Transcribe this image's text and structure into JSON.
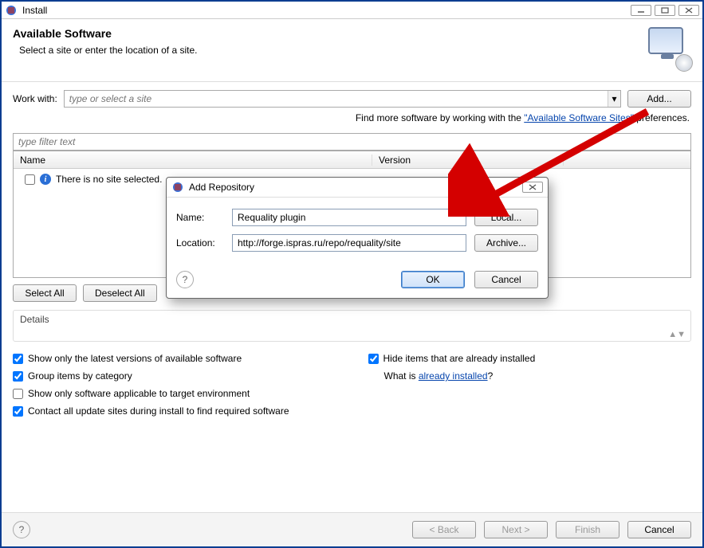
{
  "window": {
    "title": "Install",
    "min": "⎯",
    "max": "☐",
    "close": "✕"
  },
  "header": {
    "title": "Available Software",
    "subtitle": "Select a site or enter the location of a site."
  },
  "workwith": {
    "label": "Work with:",
    "placeholder": "type or select a site",
    "add_btn": "Add...",
    "hint_prefix": "Find more software by working with the ",
    "hint_link": "\"Available Software Sites\"",
    "hint_suffix": " preferences."
  },
  "filter": {
    "placeholder": "type filter text"
  },
  "table": {
    "col_name": "Name",
    "col_version": "Version",
    "empty_text": "There is no site selected."
  },
  "buttons": {
    "select_all": "Select All",
    "deselect_all": "Deselect All"
  },
  "details": {
    "label": "Details"
  },
  "checks": {
    "c1": "Show only the latest versions of available software",
    "c2": "Hide items that are already installed",
    "c3": "Group items by category",
    "c4_prefix": "What is ",
    "c4_link": "already installed",
    "c4_suffix": "?",
    "c5": "Show only software applicable to target environment",
    "c6": "Contact all update sites during install to find required software"
  },
  "footer": {
    "back": "< Back",
    "next": "Next >",
    "finish": "Finish",
    "cancel": "Cancel"
  },
  "dialog": {
    "title": "Add Repository",
    "name_label": "Name:",
    "name_value": "Requality plugin",
    "loc_label": "Location:",
    "loc_value": "http://forge.ispras.ru/repo/requality/site",
    "local_btn": "Local...",
    "archive_btn": "Archive...",
    "ok": "OK",
    "cancel": "Cancel",
    "close": "✕"
  }
}
